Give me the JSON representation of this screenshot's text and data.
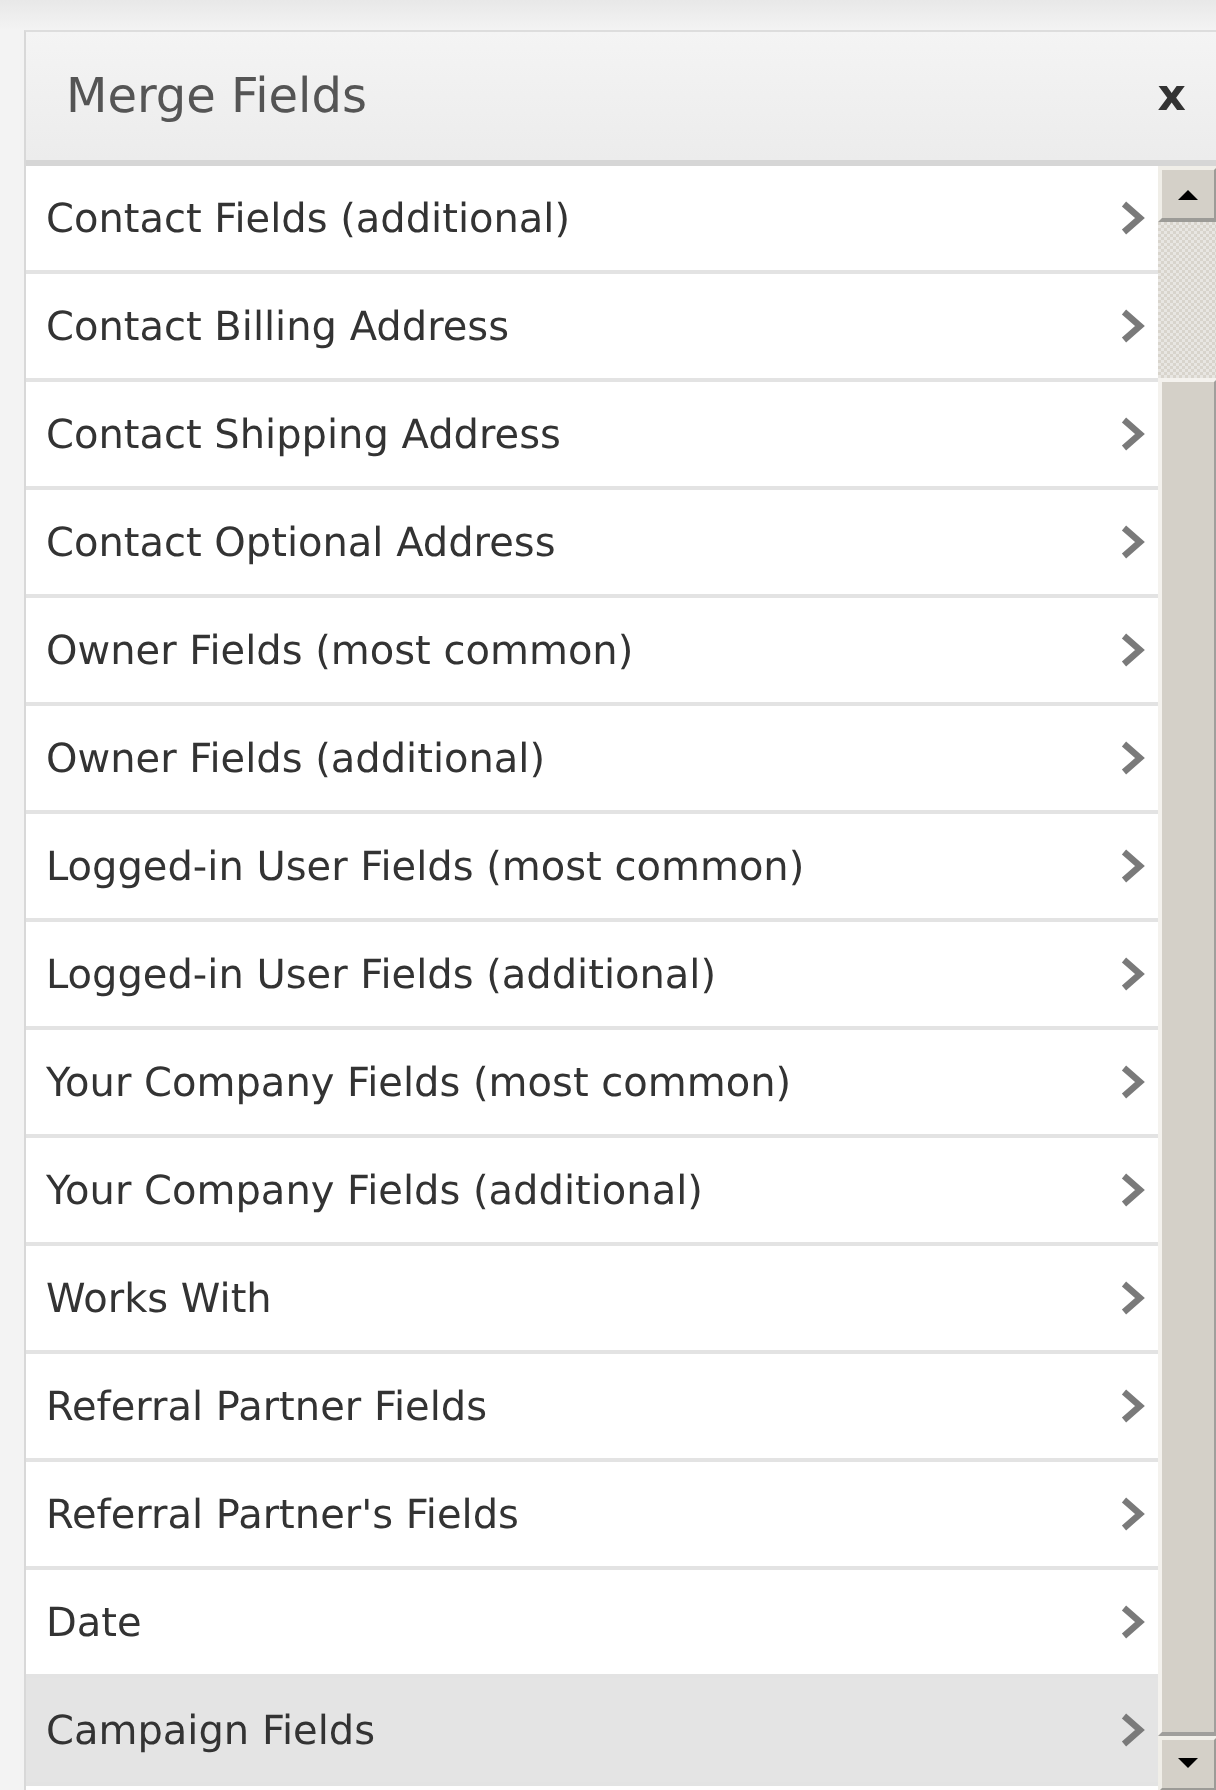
{
  "dialog": {
    "title": "Merge Fields",
    "close": "x"
  },
  "items": [
    {
      "label": "Contact Fields (additional)",
      "selected": false
    },
    {
      "label": "Contact Billing Address",
      "selected": false
    },
    {
      "label": "Contact Shipping Address",
      "selected": false
    },
    {
      "label": "Contact Optional Address",
      "selected": false
    },
    {
      "label": "Owner Fields (most common)",
      "selected": false
    },
    {
      "label": "Owner Fields (additional)",
      "selected": false
    },
    {
      "label": "Logged-in User Fields (most common)",
      "selected": false
    },
    {
      "label": "Logged-in User Fields (additional)",
      "selected": false
    },
    {
      "label": "Your Company Fields (most common)",
      "selected": false
    },
    {
      "label": "Your Company Fields (additional)",
      "selected": false
    },
    {
      "label": "Works With",
      "selected": false
    },
    {
      "label": "Referral Partner Fields",
      "selected": false
    },
    {
      "label": "Referral Partner's Fields",
      "selected": false
    },
    {
      "label": "Date",
      "selected": false
    },
    {
      "label": "Campaign Fields",
      "selected": true
    }
  ]
}
